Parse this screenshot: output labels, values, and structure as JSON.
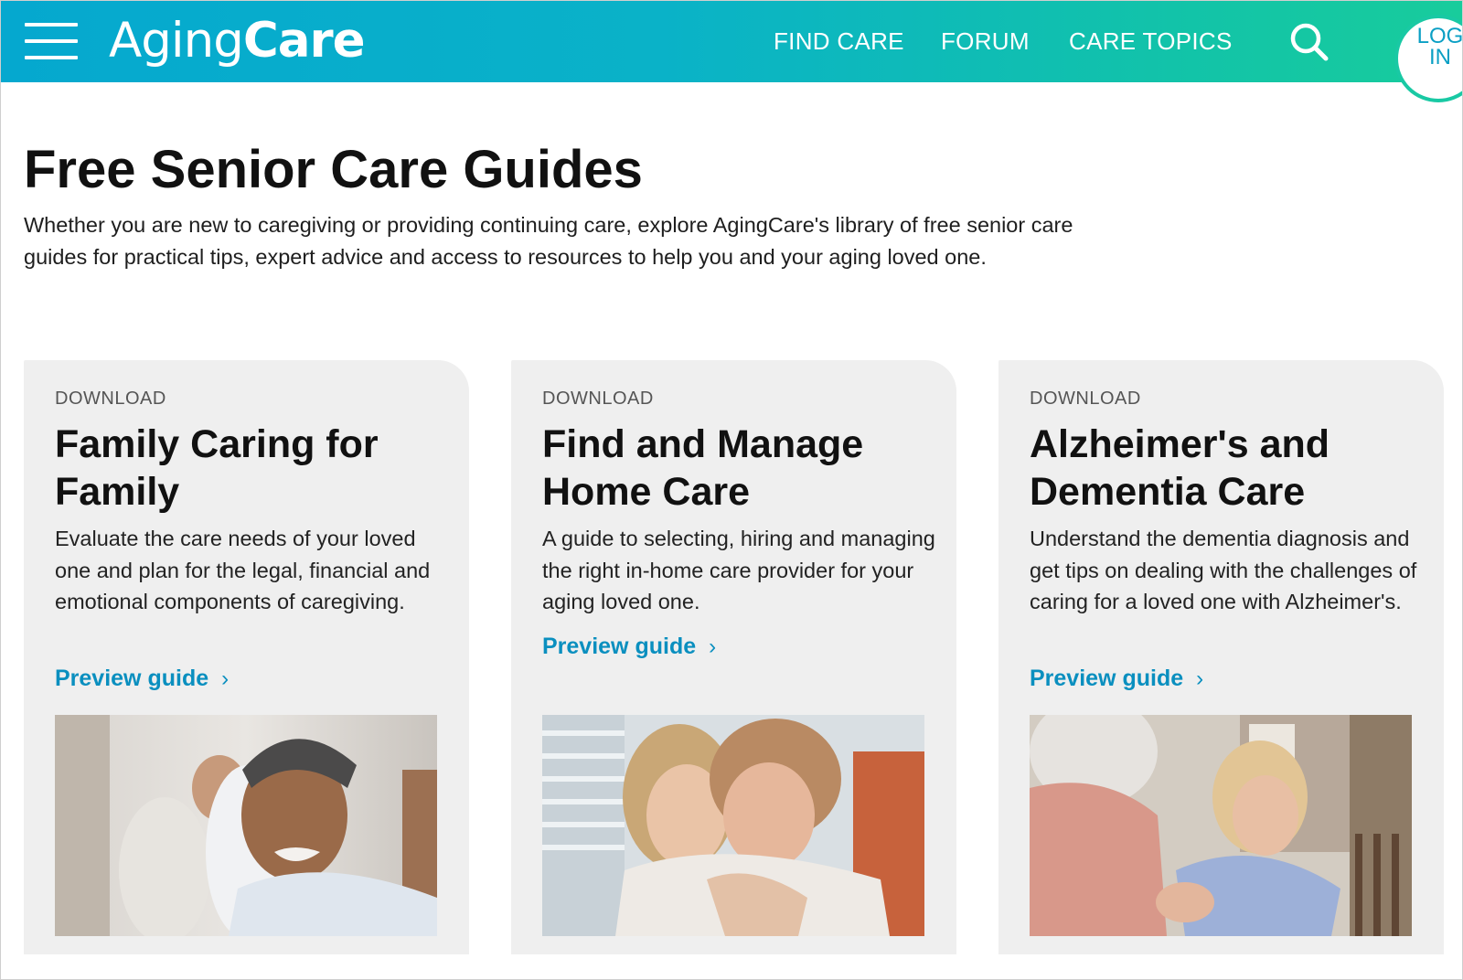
{
  "header": {
    "logo_light": "Aging",
    "logo_bold": "Care",
    "nav": [
      {
        "label": "FIND CARE"
      },
      {
        "label": "FORUM"
      },
      {
        "label": "CARE TOPICS"
      }
    ],
    "login_line1": "LOG",
    "login_line2": "IN"
  },
  "intro": {
    "title": "Free Senior Care Guides",
    "text": "Whether you are new to caregiving or providing continuing care, explore AgingCare's library of free senior care guides for practical tips, expert advice and access to resources to help you and your aging loved one."
  },
  "cards": [
    {
      "tag": "DOWNLOAD",
      "title": "Family Caring for Family",
      "description": "Evaluate the care needs of your loved one and plan for the legal, financial and emotional components of caregiving.",
      "link": "Preview guide"
    },
    {
      "tag": "DOWNLOAD",
      "title": "Find and Manage Home Care",
      "description": "A guide to selecting, hiring and managing the right in-home care provider for your aging loved one.",
      "link": "Preview guide"
    },
    {
      "tag": "DOWNLOAD",
      "title": "Alzheimer's and Dementia Care",
      "description": "Understand the dementia diagnosis and get tips on dealing with the challenges of caring for a loved one with Alzheimer's.",
      "link": "Preview guide"
    }
  ],
  "colors": {
    "header_gradient_start": "#05a8cf",
    "header_gradient_end": "#18cc9c",
    "link": "#0a8fbf",
    "card_bg": "#efefef"
  },
  "icons": {
    "menu": "hamburger-menu-icon",
    "search": "search-icon",
    "link_arrow": "chevron-right-icon"
  }
}
